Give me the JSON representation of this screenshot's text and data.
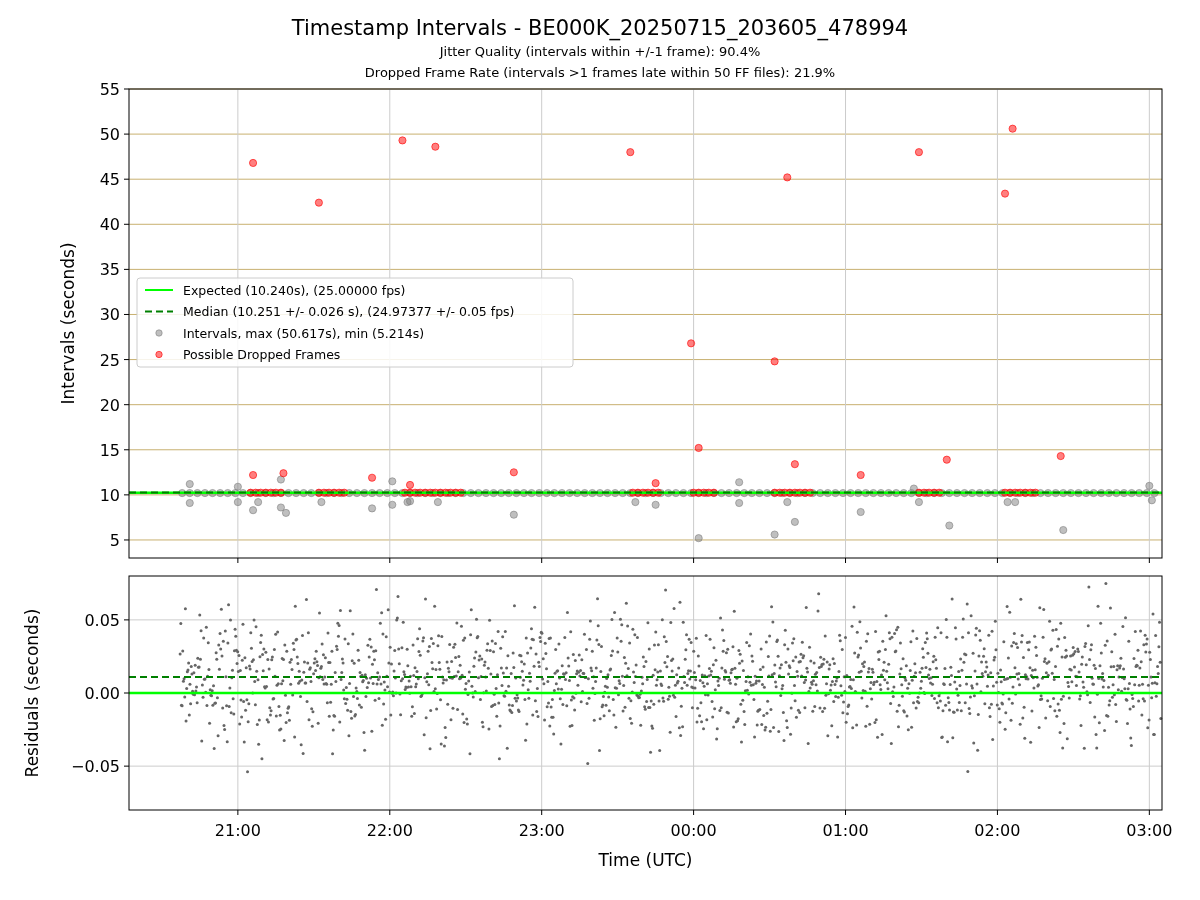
{
  "figure": {
    "title": "Timestamp Intervals - BE000K_20250715_203605_478994",
    "subtitles": [
      "Jitter Quality (intervals within +/-1 frame): 90.4%",
      "Dropped Frame Rate (intervals >1 frames late within 50 FF files): 21.9%"
    ]
  },
  "intervals_panel": {
    "chart_data": {
      "type": "scatter",
      "ylabel": "Intervals (seconds)",
      "xlim": [
        "2025-07-15T20:17",
        "2025-07-16T03:05"
      ],
      "ylim": [
        3,
        55
      ],
      "grid": true,
      "legend": "center left",
      "yticks": [
        5,
        10,
        15,
        20,
        25,
        30,
        35,
        40,
        45,
        50,
        55
      ],
      "series": [
        {
          "name": "Expected (10.240s), (25.00000 fps)",
          "type": "line",
          "line_style": "solid",
          "color": "#00ff00",
          "x": [
            "2025-07-15T20:17",
            "2025-07-16T03:05"
          ],
          "values": [
            10.24,
            10.24
          ]
        },
        {
          "name": "Median (10.251 +/- 0.026 s), (24.97377 +/- 0.05 fps)",
          "type": "line",
          "line_style": "dashed",
          "color": "#008000",
          "x": [
            "2025-07-15T20:17",
            "2025-07-16T03:05"
          ],
          "values": [
            10.251,
            10.251
          ]
        },
        {
          "name": "Intervals, max (50.617s), min (5.214s)",
          "type": "scatter",
          "color": "#808080",
          "x": [
            "2025-07-15T20:41",
            "2025-07-15T20:41",
            "2025-07-15T21:00",
            "2025-07-15T21:00",
            "2025-07-15T21:06",
            "2025-07-15T21:08",
            "2025-07-15T21:17",
            "2025-07-15T21:17",
            "2025-07-15T21:19",
            "2025-07-15T21:33",
            "2025-07-15T21:53",
            "2025-07-15T22:01",
            "2025-07-15T22:01",
            "2025-07-15T22:07",
            "2025-07-15T22:08",
            "2025-07-15T22:19",
            "2025-07-15T22:49",
            "2025-07-15T23:37",
            "2025-07-15T23:45",
            "2025-07-16T00:02",
            "2025-07-16T00:18",
            "2025-07-16T00:18",
            "2025-07-16T00:32",
            "2025-07-16T00:37",
            "2025-07-16T00:40",
            "2025-07-16T01:06",
            "2025-07-16T01:27",
            "2025-07-16T01:29",
            "2025-07-16T01:41",
            "2025-07-16T02:04",
            "2025-07-16T02:07",
            "2025-07-16T02:26",
            "2025-07-16T03:00",
            "2025-07-16T03:01",
            "2025-07-15T20:38",
            "2025-07-15T20:41",
            "2025-07-15T20:44",
            "2025-07-15T20:47",
            "2025-07-15T20:50",
            "2025-07-15T20:53",
            "2025-07-15T20:56",
            "2025-07-15T20:59",
            "2025-07-15T21:02",
            "2025-07-15T21:05",
            "2025-07-15T21:08",
            "2025-07-15T21:11",
            "2025-07-15T21:14",
            "2025-07-15T21:17",
            "2025-07-15T21:20",
            "2025-07-15T21:23",
            "2025-07-15T21:26",
            "2025-07-15T21:29",
            "2025-07-15T21:32",
            "2025-07-15T21:35",
            "2025-07-15T21:38",
            "2025-07-15T21:41",
            "2025-07-15T21:44",
            "2025-07-15T21:47",
            "2025-07-15T21:50",
            "2025-07-15T21:53",
            "2025-07-15T21:56",
            "2025-07-15T21:59",
            "2025-07-15T22:02",
            "2025-07-15T22:05",
            "2025-07-15T22:08",
            "2025-07-15T22:11",
            "2025-07-15T22:14",
            "2025-07-15T22:17",
            "2025-07-15T22:20",
            "2025-07-15T22:23",
            "2025-07-15T22:26",
            "2025-07-15T22:29",
            "2025-07-15T22:32",
            "2025-07-15T22:35",
            "2025-07-15T22:38",
            "2025-07-15T22:41",
            "2025-07-15T22:44",
            "2025-07-15T22:47",
            "2025-07-15T22:50",
            "2025-07-15T22:53",
            "2025-07-15T22:56",
            "2025-07-15T22:59",
            "2025-07-15T23:02",
            "2025-07-15T23:05",
            "2025-07-15T23:08",
            "2025-07-15T23:11",
            "2025-07-15T23:14",
            "2025-07-15T23:17",
            "2025-07-15T23:20",
            "2025-07-15T23:23",
            "2025-07-15T23:26",
            "2025-07-15T23:29",
            "2025-07-15T23:32",
            "2025-07-15T23:35",
            "2025-07-15T23:38",
            "2025-07-15T23:41",
            "2025-07-15T23:44",
            "2025-07-15T23:47",
            "2025-07-15T23:50",
            "2025-07-15T23:53",
            "2025-07-15T23:56",
            "2025-07-15T23:59",
            "2025-07-16T00:02",
            "2025-07-16T00:05",
            "2025-07-16T00:08",
            "2025-07-16T00:11",
            "2025-07-16T00:14",
            "2025-07-16T00:17",
            "2025-07-16T00:20",
            "2025-07-16T00:23",
            "2025-07-16T00:26",
            "2025-07-16T00:29",
            "2025-07-16T00:32",
            "2025-07-16T00:35",
            "2025-07-16T00:38",
            "2025-07-16T00:41",
            "2025-07-16T00:44",
            "2025-07-16T00:47",
            "2025-07-16T00:50",
            "2025-07-16T00:53",
            "2025-07-16T00:56",
            "2025-07-16T00:59",
            "2025-07-16T01:02",
            "2025-07-16T01:05",
            "2025-07-16T01:08",
            "2025-07-16T01:11",
            "2025-07-16T01:14",
            "2025-07-16T01:17",
            "2025-07-16T01:20",
            "2025-07-16T01:23",
            "2025-07-16T01:26",
            "2025-07-16T01:29",
            "2025-07-16T01:32",
            "2025-07-16T01:35",
            "2025-07-16T01:38",
            "2025-07-16T01:41",
            "2025-07-16T01:44",
            "2025-07-16T01:47",
            "2025-07-16T01:50",
            "2025-07-16T01:53",
            "2025-07-16T01:56",
            "2025-07-16T01:59",
            "2025-07-16T02:02",
            "2025-07-16T02:05",
            "2025-07-16T02:08",
            "2025-07-16T02:11",
            "2025-07-16T02:14",
            "2025-07-16T02:17",
            "2025-07-16T02:20",
            "2025-07-16T02:23",
            "2025-07-16T02:26",
            "2025-07-16T02:29",
            "2025-07-16T02:32",
            "2025-07-16T02:35",
            "2025-07-16T02:38",
            "2025-07-16T02:41",
            "2025-07-16T02:44",
            "2025-07-16T02:47",
            "2025-07-16T02:50",
            "2025-07-16T02:53",
            "2025-07-16T02:56",
            "2025-07-16T02:59",
            "2025-07-16T03:02"
          ],
          "values": [
            11.2,
            9.1,
            10.9,
            9.2,
            8.3,
            9.2,
            11.7,
            8.6,
            8.0,
            9.2,
            8.5,
            11.5,
            8.9,
            9.2,
            9.3,
            9.2,
            7.8,
            9.2,
            8.9,
            5.2,
            11.4,
            9.1,
            5.6,
            9.2,
            7.0,
            8.1,
            10.7,
            9.2,
            6.6,
            9.2,
            9.2,
            6.1,
            11.0,
            9.4,
            10.2,
            10.2,
            10.2,
            10.2,
            10.2,
            10.2,
            10.2,
            10.2,
            10.2,
            10.2,
            10.2,
            10.2,
            10.2,
            10.2,
            10.2,
            10.2,
            10.2,
            10.2,
            10.2,
            10.2,
            10.2,
            10.2,
            10.2,
            10.2,
            10.2,
            10.2,
            10.2,
            10.2,
            10.2,
            10.2,
            10.2,
            10.2,
            10.2,
            10.2,
            10.2,
            10.2,
            10.2,
            10.2,
            10.2,
            10.2,
            10.2,
            10.2,
            10.2,
            10.2,
            10.2,
            10.2,
            10.2,
            10.2,
            10.2,
            10.2,
            10.2,
            10.2,
            10.2,
            10.2,
            10.2,
            10.2,
            10.2,
            10.2,
            10.2,
            10.2,
            10.2,
            10.2,
            10.2,
            10.2,
            10.2,
            10.2,
            10.2,
            10.2,
            10.2,
            10.2,
            10.2,
            10.2,
            10.2,
            10.2,
            10.2,
            10.2,
            10.2,
            10.2,
            10.2,
            10.2,
            10.2,
            10.2,
            10.2,
            10.2,
            10.2,
            10.2,
            10.2,
            10.2,
            10.2,
            10.2,
            10.2,
            10.2,
            10.2,
            10.2,
            10.2,
            10.2,
            10.2,
            10.2,
            10.2,
            10.2,
            10.2,
            10.2,
            10.2,
            10.2,
            10.2,
            10.2,
            10.2,
            10.2,
            10.2,
            10.2,
            10.2,
            10.2,
            10.2,
            10.2,
            10.2,
            10.2,
            10.2,
            10.2,
            10.2,
            10.2,
            10.2,
            10.2,
            10.2,
            10.2,
            10.2,
            10.2,
            10.2,
            10.2,
            10.2
          ]
        },
        {
          "name": "Possible Dropped Frames",
          "type": "scatter",
          "color": "#ff0000",
          "x": [
            "2025-07-15T21:06",
            "2025-07-15T21:06",
            "2025-07-15T21:18",
            "2025-07-15T21:32",
            "2025-07-15T21:53",
            "2025-07-15T22:05",
            "2025-07-15T22:08",
            "2025-07-15T22:18",
            "2025-07-15T22:49",
            "2025-07-15T23:35",
            "2025-07-15T23:45",
            "2025-07-15T23:59",
            "2025-07-16T00:02",
            "2025-07-16T00:32",
            "2025-07-16T00:37",
            "2025-07-16T00:40",
            "2025-07-16T01:06",
            "2025-07-16T01:29",
            "2025-07-16T01:40",
            "2025-07-16T02:03",
            "2025-07-16T02:06",
            "2025-07-16T02:25",
            "2025-07-15T21:05",
            "2025-07-15T21:07",
            "2025-07-15T21:09",
            "2025-07-15T21:11",
            "2025-07-15T21:13",
            "2025-07-15T21:15",
            "2025-07-15T21:17",
            "2025-07-15T21:32",
            "2025-07-15T21:34",
            "2025-07-15T21:36",
            "2025-07-15T21:38",
            "2025-07-15T21:40",
            "2025-07-15T21:42",
            "2025-07-15T22:06",
            "2025-07-15T22:08",
            "2025-07-15T22:10",
            "2025-07-15T22:12",
            "2025-07-15T22:14",
            "2025-07-15T22:16",
            "2025-07-15T22:18",
            "2025-07-15T22:20",
            "2025-07-15T22:22",
            "2025-07-15T22:24",
            "2025-07-15T22:26",
            "2025-07-15T22:28",
            "2025-07-15T23:36",
            "2025-07-15T23:38",
            "2025-07-15T23:40",
            "2025-07-15T23:42",
            "2025-07-15T23:44",
            "2025-07-15T23:46",
            "2025-07-16T00:00",
            "2025-07-16T00:02",
            "2025-07-16T00:04",
            "2025-07-16T00:06",
            "2025-07-16T00:08",
            "2025-07-16T00:32",
            "2025-07-16T00:34",
            "2025-07-16T00:36",
            "2025-07-16T00:38",
            "2025-07-16T00:40",
            "2025-07-16T00:42",
            "2025-07-16T00:44",
            "2025-07-16T00:46",
            "2025-07-16T01:29",
            "2025-07-16T01:31",
            "2025-07-16T01:33",
            "2025-07-16T01:35",
            "2025-07-16T01:37",
            "2025-07-16T02:03",
            "2025-07-16T02:05",
            "2025-07-16T02:07",
            "2025-07-16T02:09",
            "2025-07-16T02:11",
            "2025-07-16T02:13",
            "2025-07-16T02:15"
          ],
          "values": [
            46.8,
            12.2,
            12.4,
            42.4,
            11.9,
            49.3,
            11.1,
            48.6,
            12.5,
            48.0,
            11.3,
            26.8,
            15.2,
            24.8,
            45.2,
            13.4,
            12.2,
            48.0,
            13.9,
            43.4,
            50.6,
            14.3,
            10.24,
            10.24,
            10.24,
            10.24,
            10.24,
            10.24,
            10.24,
            10.24,
            10.24,
            10.24,
            10.24,
            10.24,
            10.24,
            10.24,
            10.24,
            10.24,
            10.24,
            10.24,
            10.24,
            10.24,
            10.24,
            10.24,
            10.24,
            10.24,
            10.24,
            10.24,
            10.24,
            10.24,
            10.24,
            10.24,
            10.24,
            10.24,
            10.24,
            10.24,
            10.24,
            10.24,
            10.24,
            10.24,
            10.24,
            10.24,
            10.24,
            10.24,
            10.24,
            10.24,
            10.24,
            10.24,
            10.24,
            10.24,
            10.24,
            10.24,
            10.24,
            10.24,
            10.24,
            10.24,
            10.24,
            10.24
          ]
        }
      ]
    }
  },
  "residuals_panel": {
    "chart_data": {
      "type": "scatter",
      "xlabel": "Time (UTC)",
      "ylabel": "Residuals (seconds)",
      "xlim": [
        "2025-07-15T20:17",
        "2025-07-16T03:05"
      ],
      "ylim": [
        -0.08,
        0.08
      ],
      "grid": true,
      "xticks": [
        {
          "value": "2025-07-15T21:00",
          "label": "21:00"
        },
        {
          "value": "2025-07-15T22:00",
          "label": "22:00"
        },
        {
          "value": "2025-07-15T23:00",
          "label": "23:00"
        },
        {
          "value": "2025-07-16T00:00",
          "label": "00:00"
        },
        {
          "value": "2025-07-16T01:00",
          "label": "01:00"
        },
        {
          "value": "2025-07-16T02:00",
          "label": "02:00"
        },
        {
          "value": "2025-07-16T03:00",
          "label": "03:00"
        }
      ],
      "yticks": [
        0.05,
        {
          "value": 0,
          "label": "0.00"
        },
        {
          "value": -0.05,
          "label": "−0.05"
        }
      ],
      "series": [
        {
          "type": "line",
          "line_style": "solid",
          "color": "#00ff00",
          "x": [
            "2025-07-15T20:17",
            "2025-07-16T03:05"
          ],
          "values": [
            0,
            0
          ]
        },
        {
          "type": "line",
          "line_style": "dashed",
          "color": "#008000",
          "x": [
            "2025-07-15T20:17",
            "2025-07-16T03:05"
          ],
          "values": [
            0.011,
            0.011
          ]
        }
      ]
    }
  }
}
